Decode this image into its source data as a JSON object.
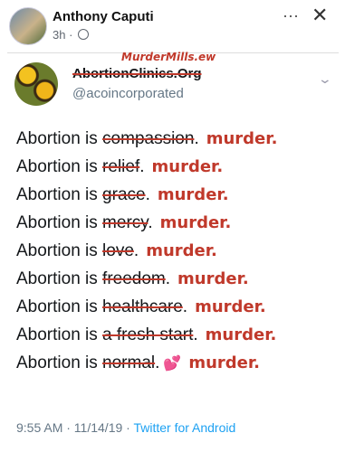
{
  "facebook": {
    "author": "Anthony Caputi",
    "time": "3h ·",
    "more_icon": "⋯",
    "close_icon": "✕"
  },
  "tweet": {
    "handwritten_name": "MurderMills.ew",
    "display_name": "AbortionClinics.Org",
    "handle": "@acoincorporated",
    "chevron_icon": "⌄",
    "lines": [
      {
        "prefix": "Abortion is ",
        "crossed": "compassion",
        "suffix": ".",
        "overwrite": "murder."
      },
      {
        "prefix": "Abortion is ",
        "crossed": "relief",
        "suffix": ".",
        "overwrite": "murder."
      },
      {
        "prefix": "Abortion is ",
        "crossed": "grace",
        "suffix": ".",
        "overwrite": "murder."
      },
      {
        "prefix": "Abortion is ",
        "crossed": "mercy",
        "suffix": ".",
        "overwrite": "murder."
      },
      {
        "prefix": "Abortion is ",
        "crossed": "love",
        "suffix": ".",
        "overwrite": "murder."
      },
      {
        "prefix": "Abortion is ",
        "crossed": "freedom",
        "suffix": ".",
        "overwrite": "murder."
      },
      {
        "prefix": "Abortion is ",
        "crossed": "healthcare",
        "suffix": ".",
        "overwrite": "murder."
      },
      {
        "prefix": "Abortion is ",
        "crossed": "a fresh start",
        "suffix": ".",
        "overwrite": "murder."
      },
      {
        "prefix": "Abortion is ",
        "crossed": "normal",
        "suffix": ".",
        "overwrite": "murder."
      }
    ],
    "timestamp": "9:55 AM · 11/14/19 · ",
    "app": "Twitter for Android"
  },
  "colors": {
    "ink_red": "#c0392b",
    "twitter_blue": "#1da1f2",
    "meta_gray": "#657786"
  }
}
